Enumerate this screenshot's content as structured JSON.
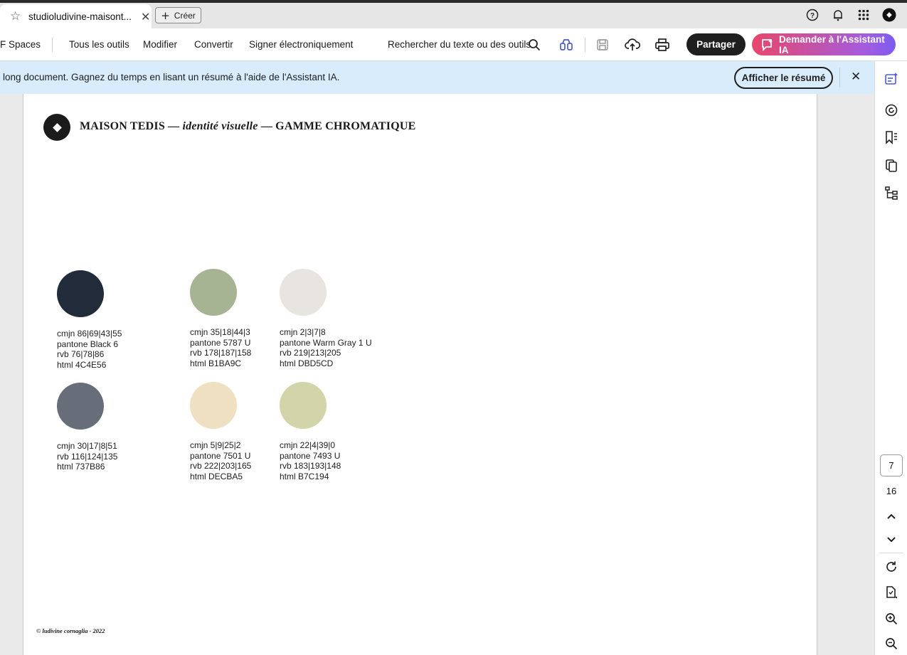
{
  "browser": {
    "tab_title": "studioludivine-maisont...",
    "tab_star_icon": "star-icon",
    "tab_close_glyph": "✕",
    "new_button_label": "Créer",
    "right_icons": [
      "help-icon",
      "bell-icon",
      "apps-grid-icon",
      "account-icon"
    ]
  },
  "toolbar": {
    "spaces_label": "F Spaces",
    "all_tools_label": "Tous les outils",
    "edit_label": "Modifier",
    "convert_label": "Convertir",
    "esign_label": "Signer électroniquement",
    "search_label": "Rechercher du texte ou des outils",
    "share_label": "Partager",
    "ai_label": "Demander à l'Assistant IA"
  },
  "banner": {
    "message": "long document. Gagnez du temps en lisant un résumé à l'aide de l'Assistant IA.",
    "summary_button": "Afficher le résumé",
    "close_glyph": "✕"
  },
  "document": {
    "title_part1": "MAISON TEDIS — ",
    "title_italic": "identité visuelle",
    "title_part2": " — GAMME CHROMATIQUE",
    "swatches": [
      {
        "color": "#222B3A",
        "lines": [
          "cmjn 86|69|43|55",
          "pantone Black 6",
          "rvb 76|78|86",
          "html 4C4E56"
        ]
      },
      {
        "color": "#A7B494",
        "lines": [
          "cmjn 35|18|44|3",
          "pantone 5787 U",
          "rvb 178|187|158",
          "html B1BA9C"
        ]
      },
      {
        "color": "#E8E5E0",
        "lines": [
          "cmjn 2|3|7|8",
          "pantone Warm Gray 1 U",
          "rvb 219|213|205",
          "html DBD5CD"
        ]
      },
      {
        "color": "#676E7A",
        "lines": [
          "cmjn 30|17|8|51",
          "rvb 116|124|135",
          "html 737B86"
        ]
      },
      {
        "color": "#F0E0C2",
        "lines": [
          "cmjn 5|9|25|2",
          "pantone 7501 U",
          "rvb 222|203|165",
          "html DECBA5"
        ]
      },
      {
        "color": "#D3D4AA",
        "lines": [
          "cmjn 22|4|39|0",
          "pantone 7493 U",
          "rvb 183|193|148",
          "html B7C194"
        ]
      }
    ],
    "footer": "© ludivine cornaglia - 2022"
  },
  "rail": {
    "current_page": "7",
    "total_pages": "16"
  },
  "colors": {
    "accent_ai_start": "#e8476a",
    "accent_ai_end": "#7b5cf0",
    "banner_bg": "#d9ecfb"
  }
}
